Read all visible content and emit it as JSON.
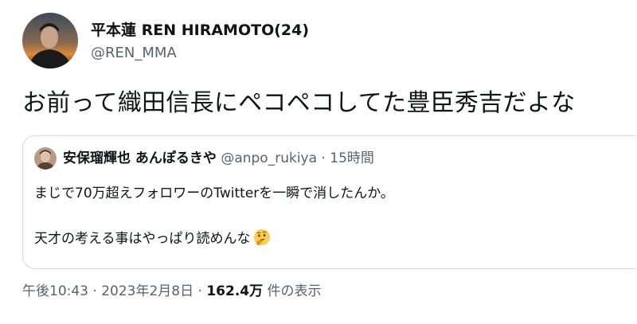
{
  "tweet": {
    "author": {
      "name": "平本蓮 REN HIRAMOTO(24)",
      "handle": "@REN_MMA",
      "avatar_icon": "profile-photo-icon"
    },
    "text": "お前って織田信長にペコペコしてた豊臣秀吉だよな",
    "quoted": {
      "author_name": "安保瑠輝也 あんぽるきや",
      "author_handle": "@anpo_rukiya",
      "separator": "·",
      "time_ago": "15時間",
      "line1": "まじで70万超えフォロワーのTwitterを一瞬で消したんか。",
      "line2": "天才の考える事はやっぱり読めんな",
      "emoji": "thinking-face-emoji"
    },
    "meta": {
      "time": "午後10:43",
      "sep1": "·",
      "date": "2023年2月8日",
      "sep2": "·",
      "view_count": "162.4万",
      "view_label": "件の表示"
    }
  },
  "colors": {
    "text_primary": "#0f1419",
    "text_secondary": "#536471",
    "border": "#cfd9de"
  }
}
